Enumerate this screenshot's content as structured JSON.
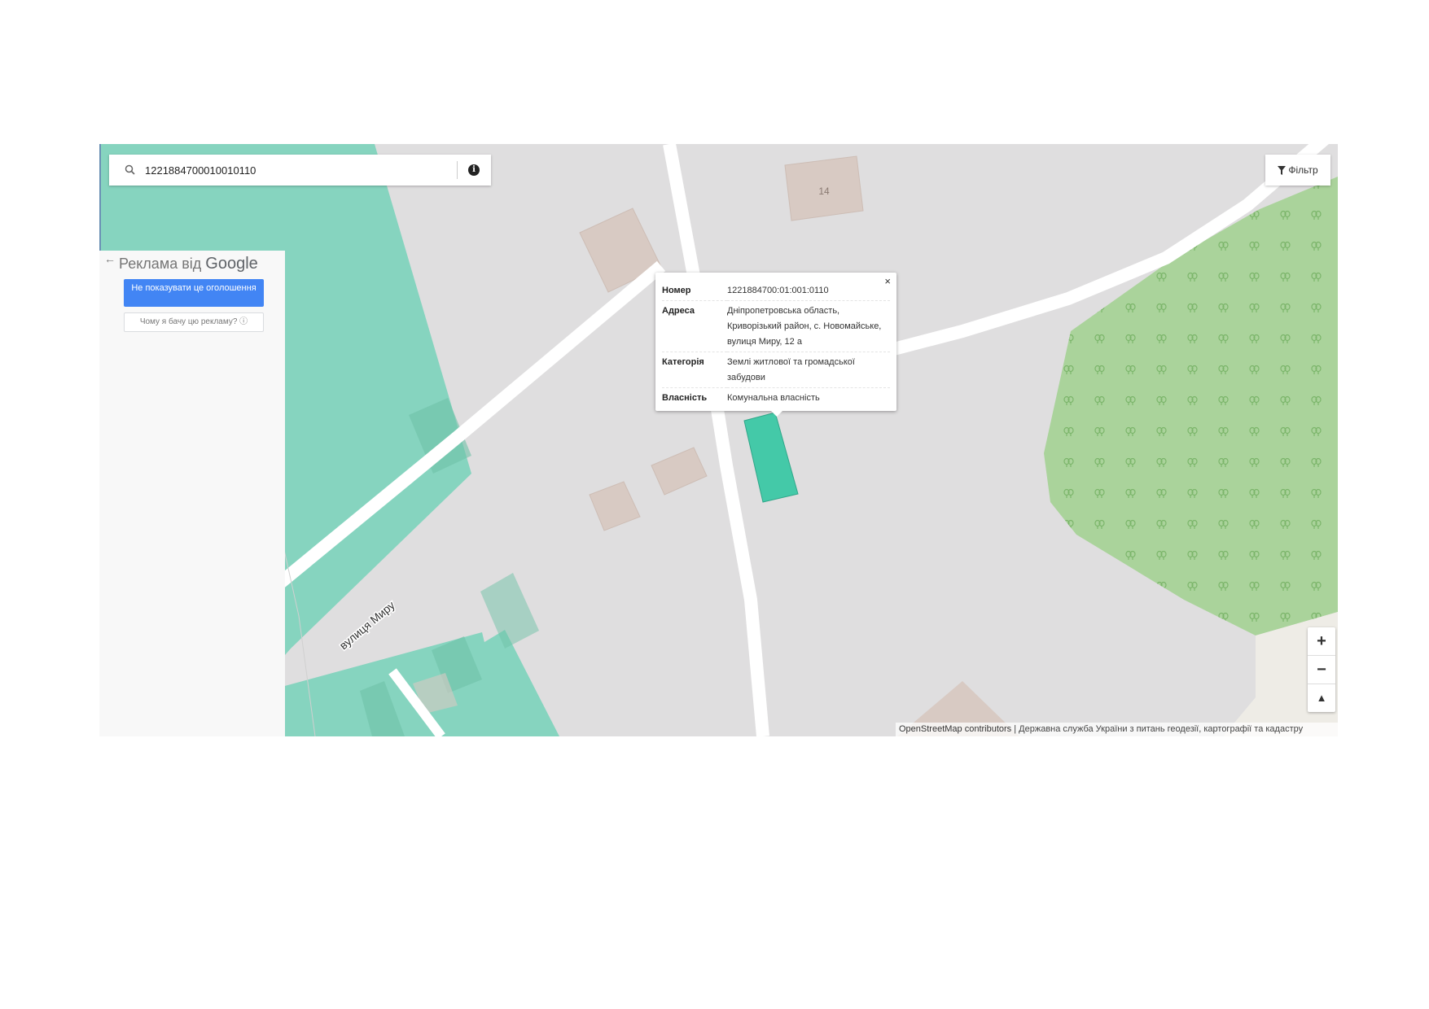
{
  "search": {
    "value": "1221884700010010110"
  },
  "filter": {
    "label": "Фільтр"
  },
  "ad": {
    "back_glyph": "←",
    "title_prefix": "Реклама від ",
    "title_brand": "Google",
    "primary_button": "Не показувати це оголошення",
    "secondary_button": "Чому я бачу цю рекламу? ⓘ"
  },
  "popup": {
    "close_glyph": "×",
    "rows": [
      {
        "key": "Номер",
        "value": "1221884700:01:001:0110"
      },
      {
        "key": "Адреса",
        "value": "Дніпропетровська область, Криворізький район, с. Новомайське, вулиця Миру, 12 а"
      },
      {
        "key": "Категорія",
        "value": "Землі житлової та громадської забудови"
      },
      {
        "key": "Власність",
        "value": "Комунальна власність"
      }
    ]
  },
  "map": {
    "street_label": "вулиця Миру",
    "house_number": "14",
    "colors": {
      "background": "#dfdedf",
      "parcel": "#86d4bf",
      "selected_parcel": "#44c9a8",
      "building": "#d8cac3",
      "forest": "#aad39b",
      "road": "#ffffff"
    }
  },
  "zoom": {
    "in": "+",
    "out": "−",
    "north": "▲"
  },
  "attribution": {
    "osm": "OpenStreetMap contributors",
    "separator": " | ",
    "agency": "Державна служба України з питань геодезії, картографії та кадастру"
  }
}
